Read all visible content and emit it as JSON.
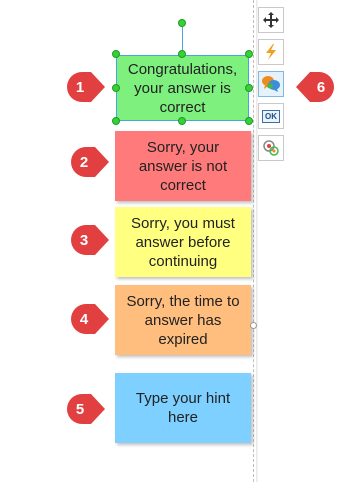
{
  "captions": [
    {
      "text": "Congratulations, your answer is correct",
      "color": "#7ef07e"
    },
    {
      "text": "Sorry, your answer is not correct",
      "color": "#ff7b7b"
    },
    {
      "text": "Sorry, you must answer before continuing",
      "color": "#ffff80"
    },
    {
      "text": "Sorry, the time to answer has expired",
      "color": "#ffbe7d"
    },
    {
      "text": "Type your hint here",
      "color": "#7dd0ff"
    }
  ],
  "markers": [
    "1",
    "2",
    "3",
    "4",
    "5",
    "6"
  ],
  "marker_color": "#e24040",
  "toolbar": {
    "items": [
      {
        "icon": "move-icon"
      },
      {
        "icon": "lightning-icon"
      },
      {
        "icon": "chat-bubbles-icon"
      },
      {
        "icon": "ok-button-icon",
        "label": "OK"
      },
      {
        "icon": "record-effects-icon"
      }
    ]
  }
}
